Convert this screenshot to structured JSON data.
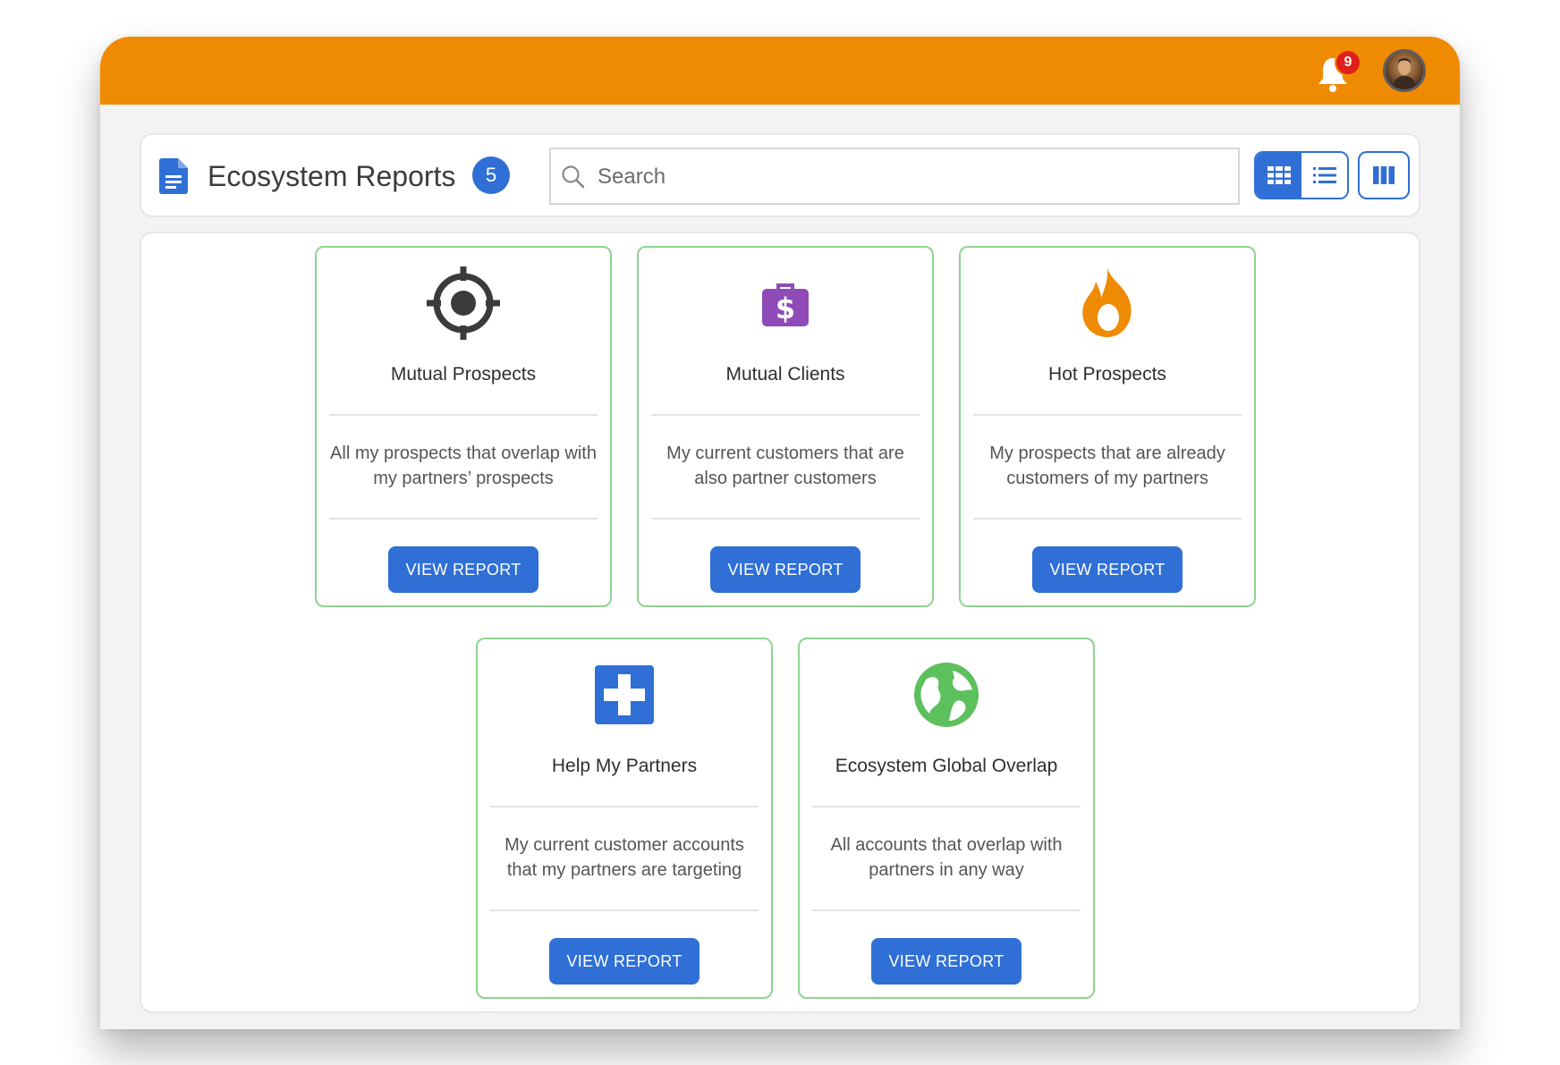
{
  "topbar": {
    "notifications_count": "9"
  },
  "header": {
    "title": "Ecosystem Reports",
    "count": "5",
    "search_placeholder": "Search"
  },
  "colors": {
    "topbar": "#ef8a03",
    "primary": "#2f6fd6",
    "card_border": "#8fd48f",
    "badge": "#e0211b"
  },
  "cards": [
    {
      "icon": "crosshair-icon",
      "title": "Mutual Prospects",
      "description": "All my prospects that overlap with my partners’ prospects",
      "button": "VIEW REPORT"
    },
    {
      "icon": "money-bag-icon",
      "title": "Mutual Clients",
      "description": "My current customers that are also partner customers",
      "button": "VIEW REPORT"
    },
    {
      "icon": "flame-icon",
      "title": "Hot Prospects",
      "description": "My prospects that are already customers of my partners",
      "button": "VIEW REPORT"
    },
    {
      "icon": "medical-plus-icon",
      "title": "Help My Partners",
      "description": "My current customer accounts that my partners are targeting",
      "button": "VIEW REPORT"
    },
    {
      "icon": "globe-icon",
      "title": "Ecosystem Global Overlap",
      "description": "All accounts that overlap with partners in any way",
      "button": "VIEW REPORT"
    }
  ]
}
